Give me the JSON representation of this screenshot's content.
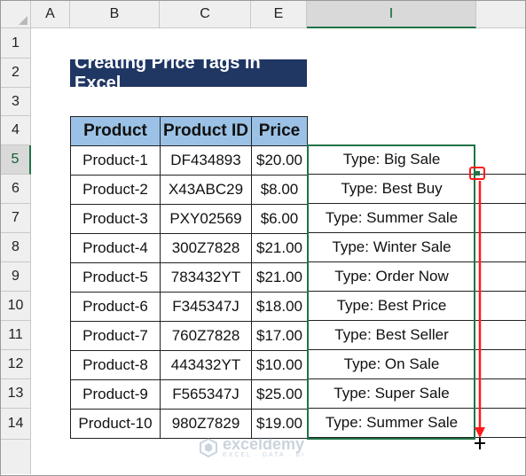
{
  "columns": [
    "A",
    "B",
    "C",
    "E",
    "I"
  ],
  "rows": [
    "1",
    "2",
    "3",
    "4",
    "5",
    "6",
    "7",
    "8",
    "9",
    "10",
    "11",
    "12",
    "13",
    "14"
  ],
  "selected_column": "I",
  "selected_row": "5",
  "title": "Creating Price Tags in Excel",
  "table": {
    "headers": [
      "Product",
      "Product ID",
      "Price"
    ],
    "rows": [
      [
        "Product-1",
        "DF434893",
        "$20.00"
      ],
      [
        "Product-2",
        "X43ABC29",
        "$8.00"
      ],
      [
        "Product-3",
        "PXY02569",
        "$6.00"
      ],
      [
        "Product-4",
        "300Z7828",
        "$21.00"
      ],
      [
        "Product-5",
        "783432YT",
        "$21.00"
      ],
      [
        "Product-6",
        "F345347J",
        "$18.00"
      ],
      [
        "Product-7",
        "760Z7828",
        "$17.00"
      ],
      [
        "Product-8",
        "443432YT",
        "$10.00"
      ],
      [
        "Product-9",
        "F565347J",
        "$25.00"
      ],
      [
        "Product-10",
        "980Z7829",
        "$19.00"
      ]
    ]
  },
  "types": [
    "Type: Big Sale",
    "Type: Best Buy",
    "Type: Summer Sale",
    "Type: Winter Sale",
    "Type: Order Now",
    "Type: Best Price",
    "Type: Best Seller",
    "Type: On Sale",
    "Type: Super Sale",
    "Type: Summer Sale"
  ],
  "watermark": {
    "name": "exceldemy",
    "tagline": "EXCEL · DATA · BI"
  },
  "colors": {
    "title_bg": "#203764",
    "header_bg": "#9bc2e6",
    "selection": "#217346",
    "annotation": "#ff1a1a"
  }
}
